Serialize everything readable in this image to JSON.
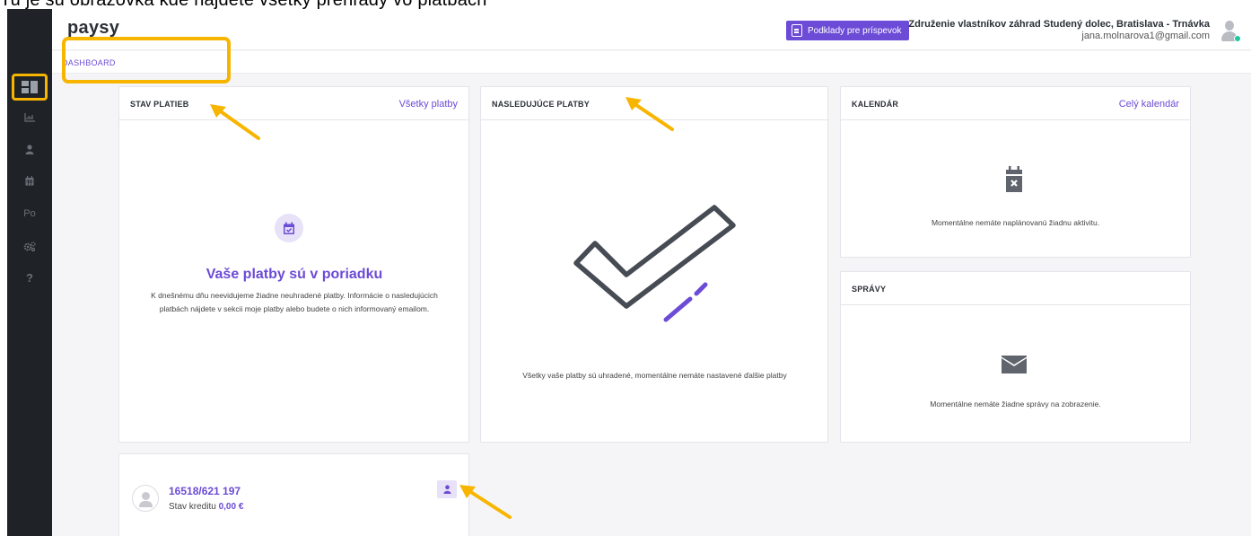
{
  "top_instruction": "Tu je sú obrazovka kde nájdete všetky prehľady vo platbách",
  "brand": {
    "logo": "paysy",
    "accent": "#6c4bd6",
    "highlight": "#f7b500",
    "sidebar_bg": "#1f2227"
  },
  "header": {
    "podklady_label": "Podklady pre príspevok",
    "org_name": "Združenie vlastníkov záhrad Studený dolec, Bratislava - Trnávka",
    "email": "jana.molnarova1@gmail.com"
  },
  "breadcrumb": "DASHBOARD",
  "sidebar": {
    "items": [
      {
        "icon": "dashboard-icon"
      },
      {
        "icon": "chart-icon"
      },
      {
        "icon": "user-icon"
      },
      {
        "icon": "calendar-icon"
      },
      {
        "icon": "po-icon",
        "label": "Po"
      },
      {
        "icon": "settings-icon"
      },
      {
        "icon": "help-icon",
        "label": "?"
      }
    ]
  },
  "stav_platieb": {
    "title": "STAV PLATIEB",
    "link": "Všetky platby",
    "heading": "Vaše platby sú v poriadku",
    "text": "K dnešnému dňu neevidujeme žiadne neuhradené platby. Informácie o nasledujúcich platbách nájdete v sekcii moje platby alebo budete o nich informovaný emailom."
  },
  "nasledujuce_platby": {
    "title": "NASLEDUJÚCE PLATBY",
    "text": "Všetky vaše platby sú uhradené, momentálne nemáte nastavené ďalšie platby"
  },
  "kalendar": {
    "title": "KALENDÁR",
    "link": "Celý kalendár",
    "text": "Momentálne nemáte naplánovanú žiadnu aktivitu."
  },
  "spravy": {
    "title": "SPRÁVY",
    "text": "Momentálne nemáte žiadne správy na zobrazenie."
  },
  "account": {
    "number": "16518/621 197",
    "credit_label": "Stav kreditu",
    "credit_value": "0,00 €"
  }
}
